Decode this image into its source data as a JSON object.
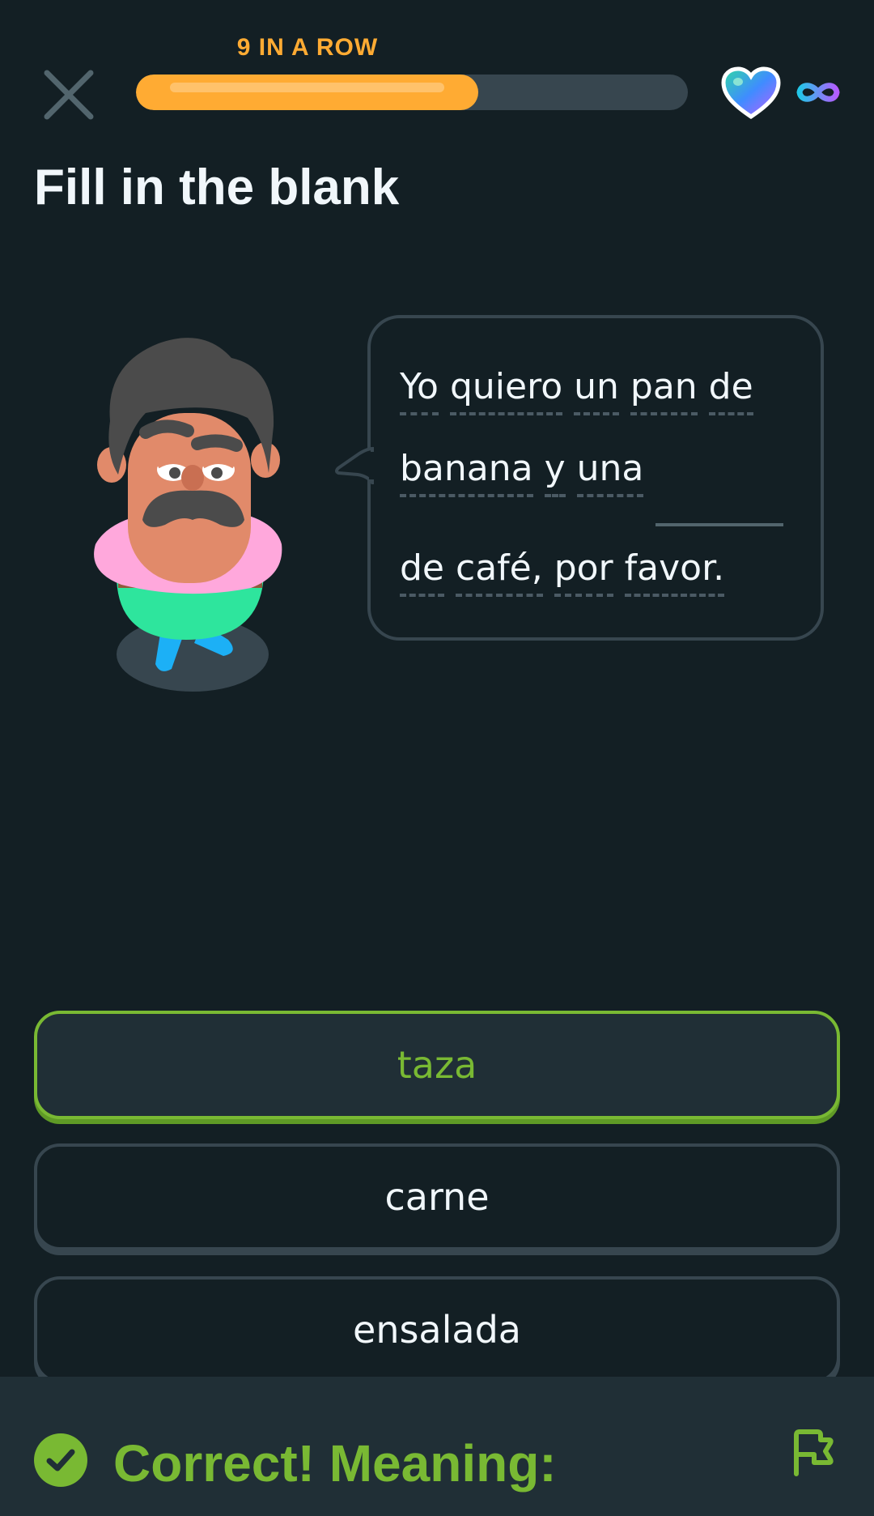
{
  "header": {
    "streak_label": "9 IN A ROW",
    "progress_fraction": 0.62,
    "close_icon": "close-icon",
    "heart_icon": "gradient-heart-icon",
    "hearts_value_icon": "infinity-icon"
  },
  "exercise": {
    "title": "Fill in the blank",
    "lines": [
      [
        "Yo",
        "quiero",
        "un",
        "pan",
        "de"
      ],
      [
        "banana",
        "y",
        "una"
      ],
      [
        "de",
        "café,",
        "por",
        "favor."
      ]
    ]
  },
  "options": [
    {
      "label": "taza",
      "selected": true
    },
    {
      "label": "carne",
      "selected": false
    },
    {
      "label": "ensalada",
      "selected": false
    }
  ],
  "footer": {
    "feedback": "Correct! Meaning:",
    "status_icon": "check-circle-icon",
    "report_icon": "flag-icon"
  },
  "colors": {
    "background": "#131f24",
    "accent_orange": "#ffab33",
    "correct_green": "#79b933",
    "border_gray": "#37464f"
  }
}
